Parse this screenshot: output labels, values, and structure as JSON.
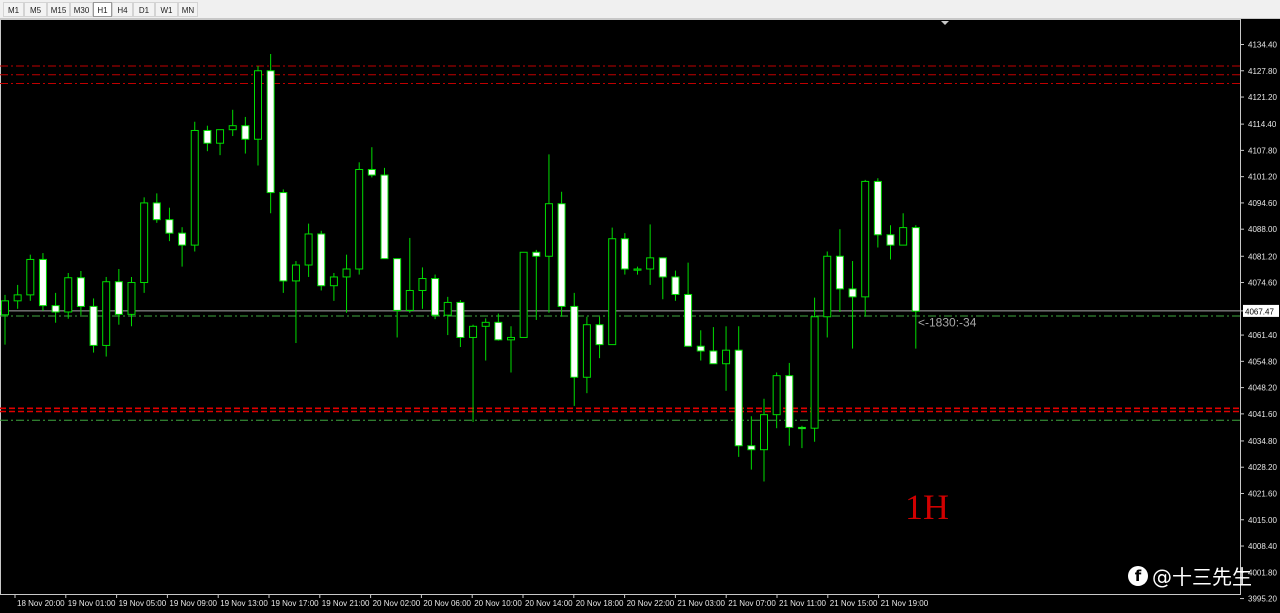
{
  "toolbar": {
    "timeframes": [
      "M1",
      "M5",
      "M15",
      "M30",
      "H1",
      "H4",
      "D1",
      "W1",
      "MN"
    ],
    "active": "H1"
  },
  "chart_data": {
    "type": "candlestick",
    "timeframe_label": "1H",
    "current_price": "4067.47",
    "order_label": "<-1830:-34",
    "price_ticks": [
      "4134.40",
      "4127.80",
      "4121.20",
      "4114.40",
      "4107.80",
      "4101.20",
      "4094.60",
      "4088.00",
      "4081.20",
      "4074.60",
      "4067.47",
      "4061.40",
      "4054.80",
      "4048.20",
      "4041.60",
      "4034.80",
      "4028.20",
      "4021.60",
      "4015.00",
      "4008.40",
      "4001.80",
      "3995.20"
    ],
    "time_ticks": [
      "18 Nov 20:00",
      "19 Nov 01:00",
      "19 Nov 05:00",
      "19 Nov 09:00",
      "19 Nov 13:00",
      "19 Nov 17:00",
      "19 Nov 21:00",
      "20 Nov 02:00",
      "20 Nov 06:00",
      "20 Nov 10:00",
      "20 Nov 14:00",
      "20 Nov 18:00",
      "20 Nov 22:00",
      "21 Nov 03:00",
      "21 Nov 07:00",
      "21 Nov 11:00",
      "21 Nov 15:00",
      "21 Nov 19:00"
    ],
    "levels_red": [
      4129.0,
      4126.8,
      4124.6,
      4043.0,
      4042.2
    ],
    "levels_green": [
      4066.2,
      4040.0
    ],
    "candles": [
      [
        4066.5,
        4071.5,
        4059.0,
        4070.0
      ],
      [
        4070.0,
        4074.0,
        4068.0,
        4071.5
      ],
      [
        4071.5,
        4081.6,
        4070.0,
        4080.4
      ],
      [
        4080.4,
        4082.0,
        4067.5,
        4068.8
      ],
      [
        4068.8,
        4072.0,
        4064.5,
        4067.2
      ],
      [
        4067.2,
        4077.0,
        4065.5,
        4075.8
      ],
      [
        4075.8,
        4077.5,
        4066.4,
        4068.6
      ],
      [
        4068.6,
        4070.6,
        4057.0,
        4058.8
      ],
      [
        4058.8,
        4076.0,
        4056.0,
        4074.8
      ],
      [
        4074.8,
        4078.0,
        4064.0,
        4066.6
      ],
      [
        4066.6,
        4076.0,
        4063.6,
        4074.6
      ],
      [
        4074.6,
        4096.0,
        4072.0,
        4094.6
      ],
      [
        4094.6,
        4097.0,
        4089.6,
        4090.4
      ],
      [
        4090.4,
        4093.4,
        4085.0,
        4087.0
      ],
      [
        4087.0,
        4088.5,
        4078.6,
        4084.0
      ],
      [
        4084.0,
        4115.0,
        4082.4,
        4112.8
      ],
      [
        4112.8,
        4114.0,
        4107.6,
        4109.6
      ],
      [
        4109.6,
        4113.0,
        4106.6,
        4113.0
      ],
      [
        4113.0,
        4118.0,
        4111.4,
        4114.0
      ],
      [
        4114.0,
        4116.2,
        4107.0,
        4110.6
      ],
      [
        4110.6,
        4129.0,
        4104.0,
        4127.8
      ],
      [
        4127.8,
        4132.0,
        4092.0,
        4097.2
      ],
      [
        4097.2,
        4098.0,
        4072.0,
        4075.0
      ],
      [
        4075.0,
        4080.0,
        4059.4,
        4079.0
      ],
      [
        4079.0,
        4089.4,
        4076.0,
        4086.8
      ],
      [
        4086.8,
        4087.6,
        4072.6,
        4073.8
      ],
      [
        4073.8,
        4077.0,
        4070.0,
        4076.0
      ],
      [
        4076.0,
        4081.6,
        4067.0,
        4078.0
      ],
      [
        4078.0,
        4104.8,
        4076.6,
        4103.0
      ],
      [
        4103.0,
        4108.6,
        4101.0,
        4101.6
      ],
      [
        4101.6,
        4103.4,
        4080.6,
        4080.6
      ],
      [
        4080.6,
        4080.6,
        4060.8,
        4067.6
      ],
      [
        4067.6,
        4085.8,
        4067.0,
        4072.6
      ],
      [
        4072.6,
        4078.4,
        4068.0,
        4075.6
      ],
      [
        4075.6,
        4076.6,
        4065.4,
        4066.4
      ],
      [
        4066.4,
        4071.0,
        4061.4,
        4069.6
      ],
      [
        4069.6,
        4070.2,
        4058.4,
        4060.8
      ],
      [
        4060.8,
        4064.0,
        4039.6,
        4063.6
      ],
      [
        4063.6,
        4065.6,
        4055.0,
        4064.6
      ],
      [
        4064.6,
        4066.8,
        4060.0,
        4060.2
      ],
      [
        4060.2,
        4063.6,
        4052.0,
        4060.8
      ],
      [
        4060.8,
        4071.0,
        4060.8,
        4082.2
      ],
      [
        4082.2,
        4082.8,
        4065.2,
        4081.2
      ],
      [
        4081.2,
        4106.8,
        4067.0,
        4094.4
      ],
      [
        4094.4,
        4097.4,
        4066.0,
        4068.6
      ],
      [
        4068.6,
        4072.0,
        4043.6,
        4050.8
      ],
      [
        4050.8,
        4066.0,
        4046.8,
        4064.0
      ],
      [
        4064.0,
        4066.0,
        4055.6,
        4059.0
      ],
      [
        4059.0,
        4088.4,
        4059.0,
        4085.6
      ],
      [
        4085.6,
        4087.0,
        4076.6,
        4078.0
      ],
      [
        4078.0,
        4078.6,
        4076.6,
        4078.0
      ],
      [
        4078.0,
        4089.2,
        4074.0,
        4080.8
      ],
      [
        4080.8,
        4080.8,
        4070.4,
        4076.0
      ],
      [
        4076.0,
        4077.6,
        4070.0,
        4071.6
      ],
      [
        4071.6,
        4079.6,
        4060.6,
        4058.6
      ],
      [
        4058.6,
        4062.6,
        4055.0,
        4057.4
      ],
      [
        4057.4,
        4063.4,
        4055.0,
        4054.2
      ],
      [
        4054.2,
        4063.6,
        4047.4,
        4057.6
      ],
      [
        4057.6,
        4063.6,
        4030.8,
        4033.6
      ],
      [
        4033.6,
        4041.0,
        4027.6,
        4032.6
      ],
      [
        4032.6,
        4045.4,
        4024.6,
        4041.4
      ],
      [
        4041.4,
        4052.0,
        4038.0,
        4051.2
      ],
      [
        4051.2,
        4054.4,
        4033.6,
        4038.2
      ],
      [
        4038.2,
        4038.6,
        4033.0,
        4038.0
      ],
      [
        4038.0,
        4070.8,
        4034.6,
        4066.0
      ],
      [
        4066.0,
        4082.4,
        4060.8,
        4081.2
      ],
      [
        4081.2,
        4088.0,
        4067.2,
        4073.0
      ],
      [
        4073.0,
        4080.0,
        4058.0,
        4071.0
      ],
      [
        4071.0,
        4100.4,
        4066.0,
        4100.0
      ],
      [
        4100.0,
        4100.8,
        4083.4,
        4086.6
      ],
      [
        4086.6,
        4089.0,
        4080.4,
        4084.0
      ],
      [
        4084.0,
        4092.0,
        4087.8,
        4088.4
      ],
      [
        4088.4,
        4089.0,
        4058.0,
        4067.4
      ]
    ]
  }
}
